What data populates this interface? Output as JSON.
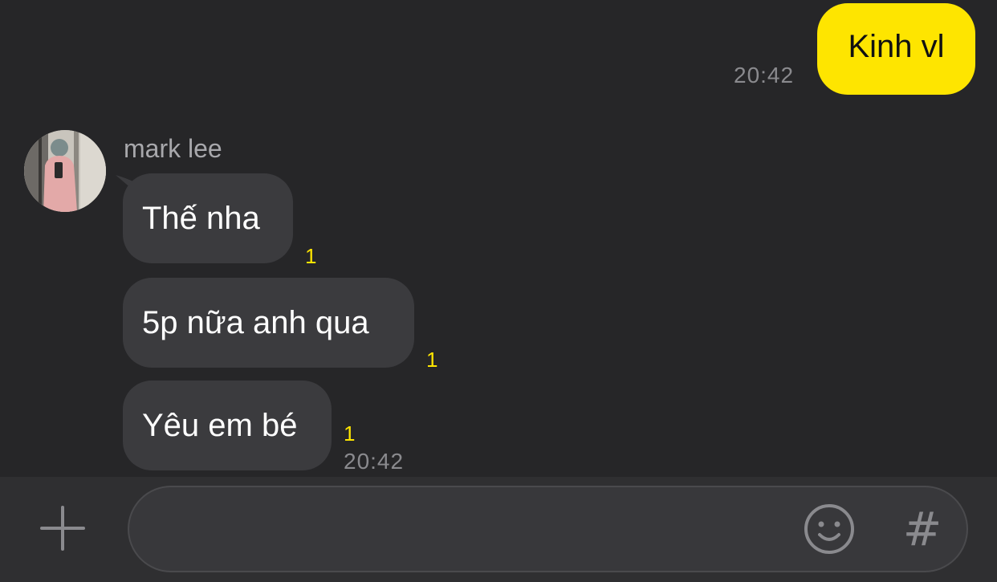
{
  "outgoing": {
    "text": "Kinh vl",
    "time": "20:42",
    "bubble_color": "#FEE500"
  },
  "incoming": {
    "sender": "mark lee",
    "avatar_icon": "profile-photo",
    "messages": [
      {
        "text": "Thế nha",
        "unread": "1"
      },
      {
        "text": "5p nữa anh qua",
        "unread": "1"
      },
      {
        "text": "Yêu em bé",
        "unread": "1"
      }
    ],
    "time": "20:42",
    "bubble_color": "#3b3b3e",
    "unread_color": "#FEE500"
  },
  "input_bar": {
    "plus_icon": "plus-icon",
    "placeholder": "",
    "emoji_icon": "smiley-icon",
    "hash_label": "#"
  },
  "colors": {
    "background": "#262628",
    "input_bar": "#2f2f31"
  }
}
